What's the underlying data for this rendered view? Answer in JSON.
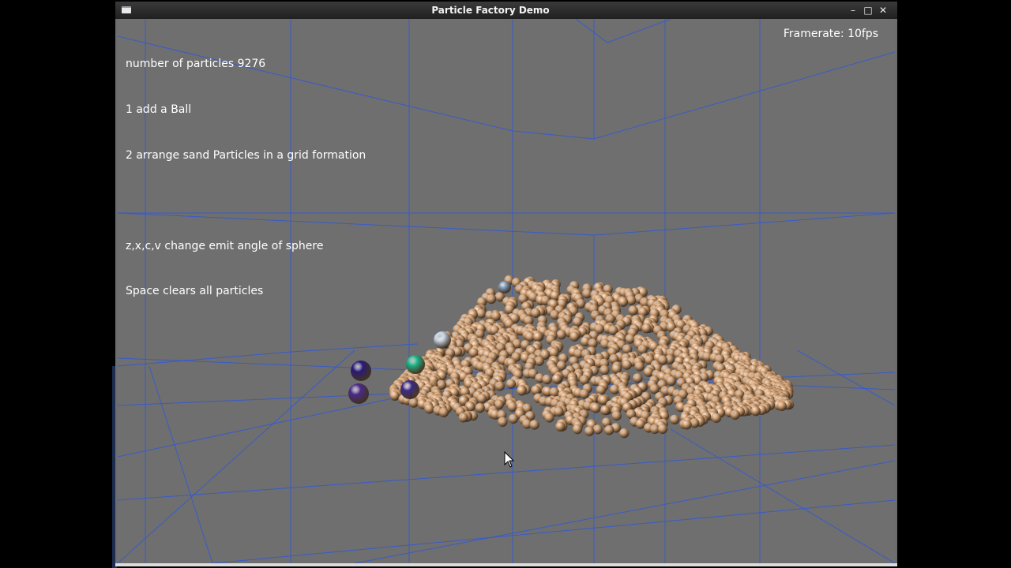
{
  "window": {
    "title": "Particle Factory Demo",
    "controls": {
      "minimize": "–",
      "maximize": "□",
      "close": "✕"
    }
  },
  "hud": {
    "particle_count_line": "number of particles 9276",
    "particle_count": 9276,
    "line_add_ball": "1 add a Ball",
    "line_grid": "2 arrange sand Particles in a grid formation",
    "line_blank": "",
    "line_emit_angle": "z,x,c,v change emit angle of sphere",
    "line_space": "Space clears all particles",
    "framerate": "Framerate: 10fps"
  },
  "scene": {
    "background_color": "#6f6f6f",
    "grid_color": "#2f58d8",
    "sand_color": "#d9a77a",
    "balls": [
      {
        "name": "dark-blue-ball",
        "color": "#2a1a7a"
      },
      {
        "name": "purple-ball",
        "color": "#4b2a8a"
      },
      {
        "name": "teal-ball",
        "color": "#19b98a"
      },
      {
        "name": "indigo-ball",
        "color": "#3a2a8a"
      },
      {
        "name": "light-blue-ball",
        "color": "#c9d8ec"
      },
      {
        "name": "steel-blue-ball",
        "color": "#7fa0c8"
      }
    ]
  }
}
